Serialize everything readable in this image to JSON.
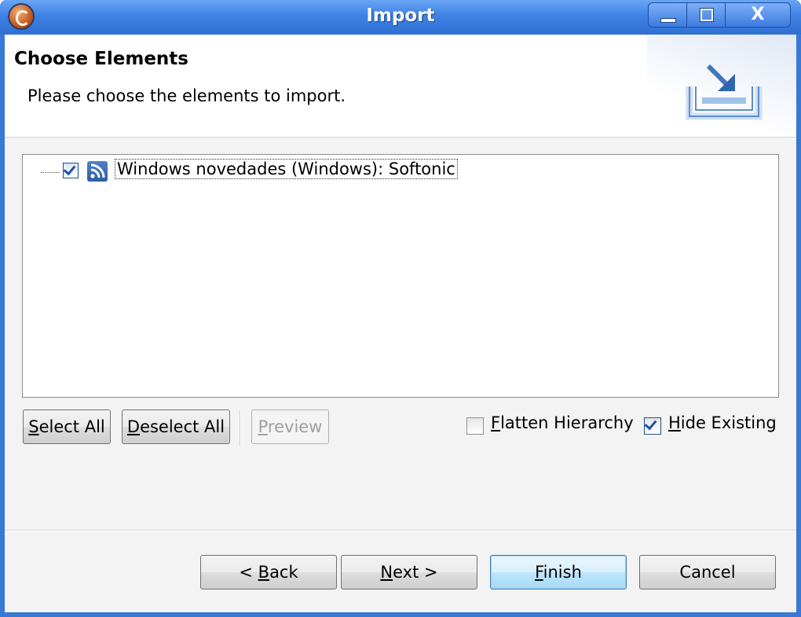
{
  "window": {
    "title": "Import",
    "controls": [
      "minimize",
      "maximize",
      "close"
    ],
    "close_glyph": "X"
  },
  "header": {
    "title": "Choose Elements",
    "subtitle": "Please choose the elements to import.",
    "icon": "import-tray-icon"
  },
  "tree": {
    "items": [
      {
        "label": "Windows novedades (Windows): Softonic",
        "checked": true,
        "icon": "rss-feed-icon"
      }
    ]
  },
  "actions": {
    "select_all": {
      "mnemonic": "S",
      "rest": "elect All"
    },
    "deselect_all": {
      "mnemonic": "D",
      "rest": "eselect All"
    },
    "preview": {
      "mnemonic": "P",
      "rest": "review",
      "enabled": false
    }
  },
  "options": {
    "flatten": {
      "mnemonic": "F",
      "rest": "latten Hierarchy",
      "checked": false
    },
    "hide_existing": {
      "mnemonic": "H",
      "rest": "ide Existing",
      "checked": true
    }
  },
  "footer": {
    "back": {
      "pre": "< ",
      "mnemonic": "B",
      "rest": "ack"
    },
    "next": {
      "mnemonic": "N",
      "rest": "ext >"
    },
    "finish": {
      "mnemonic": "F",
      "rest": "inish"
    },
    "cancel": {
      "label": "Cancel"
    }
  }
}
